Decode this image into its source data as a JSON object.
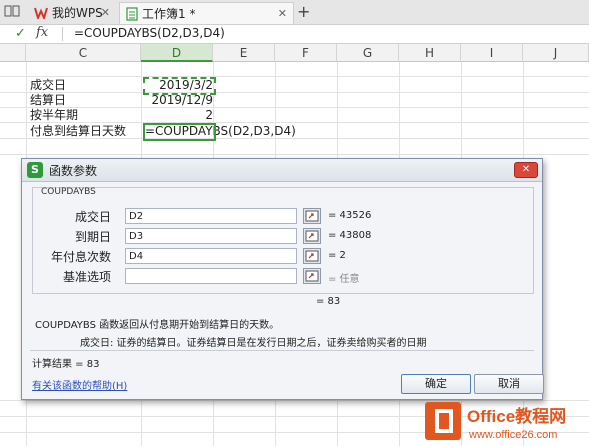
{
  "tabs": [
    {
      "label": "我的WPS",
      "closable": true
    },
    {
      "label": "工作簿1 *",
      "closable": true
    }
  ],
  "formula_bar": {
    "check": "✓",
    "fx": "fx",
    "formula": "=COUPDAYBS(D2,D3,D4)"
  },
  "columns": [
    "C",
    "D",
    "E",
    "F",
    "G",
    "H",
    "I",
    "J"
  ],
  "rows": [
    {
      "label": "成交日",
      "value": "2019/3/2"
    },
    {
      "label": "结算日",
      "value": "2019/12/9"
    },
    {
      "label": "按半年期",
      "value": "2"
    },
    {
      "label": "付息到结算日天数",
      "value": "=COUPDAYBS(D2,D3,D4)"
    }
  ],
  "dialog": {
    "title": "函数参数",
    "group_label": "COUPDAYBS",
    "args": [
      {
        "label": "成交日",
        "value": "D2",
        "result": "= 43526"
      },
      {
        "label": "到期日",
        "value": "D3",
        "result": "= 43808"
      },
      {
        "label": "年付息次数",
        "value": "D4",
        "result": "= 2"
      },
      {
        "label": "基准选项",
        "value": "",
        "result": "= 任意"
      }
    ],
    "overall_result": "= 83",
    "description": "COUPDAYBS 函数返回从付息期开始到结算日的天数。",
    "param_desc": "成交日:   证券的结算日。证券结算日是在发行日期之后，证券卖给购买者的日期",
    "calc_result": "计算结果 = 83",
    "help_link": "有关该函数的帮助(H)",
    "ok": "确定",
    "cancel": "取消"
  },
  "watermark": {
    "title": "Office教程网",
    "url": "www.office26.com"
  }
}
